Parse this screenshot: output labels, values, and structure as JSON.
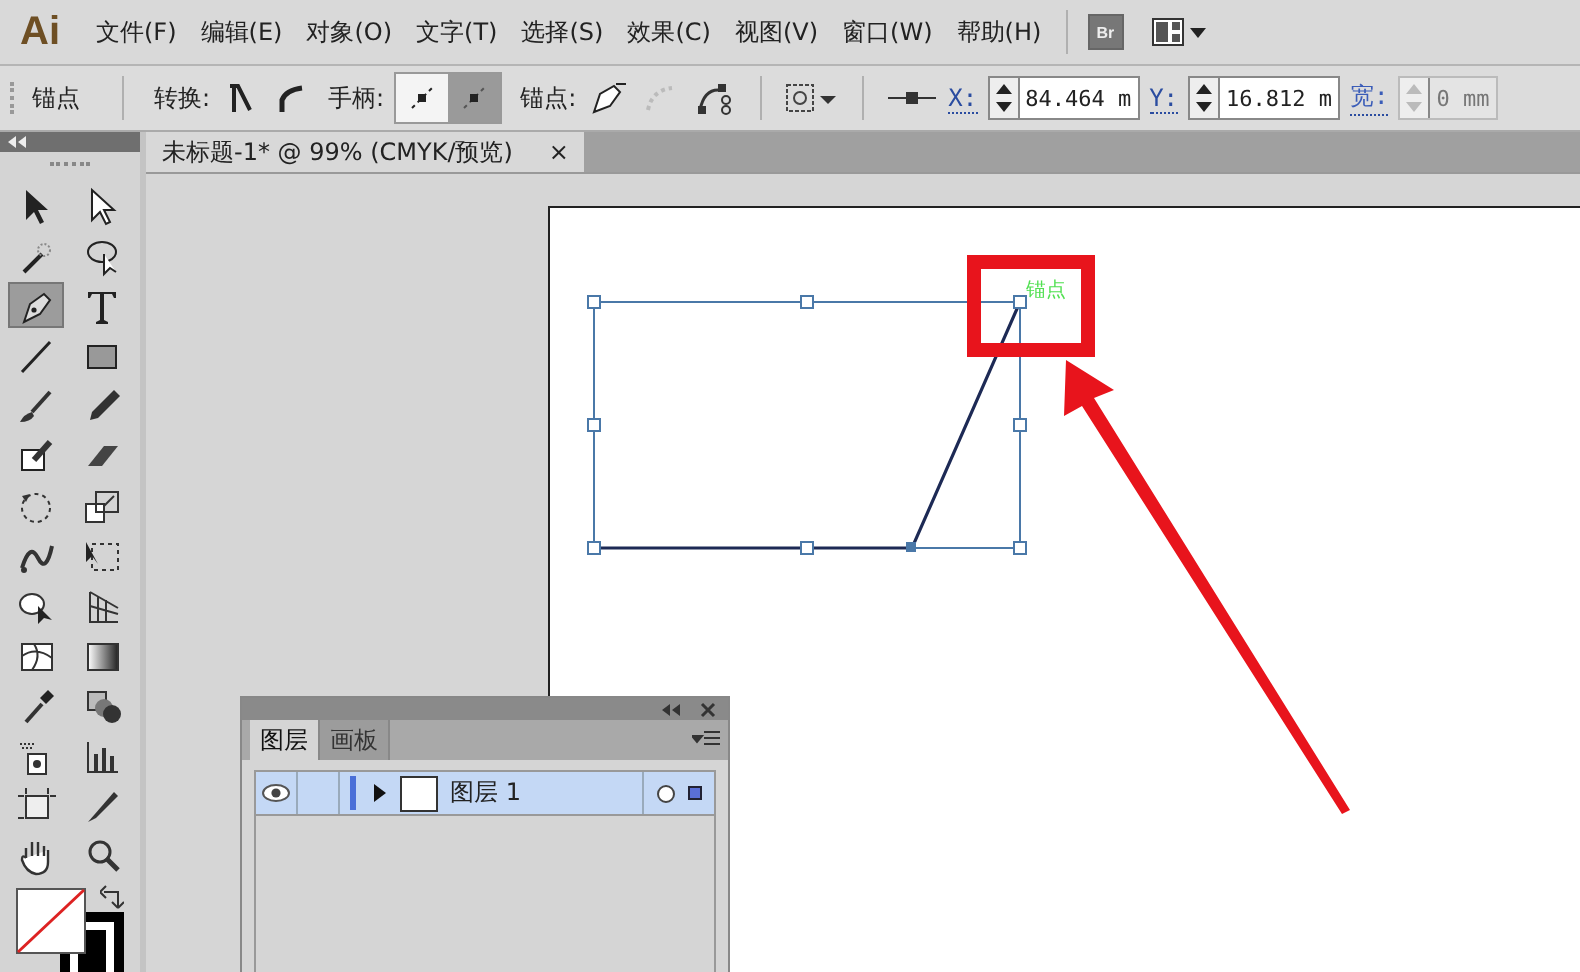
{
  "app": {
    "logo": "Ai",
    "bridge": "Br"
  },
  "menu": [
    "文件(F)",
    "编辑(E)",
    "对象(O)",
    "文字(T)",
    "选择(S)",
    "效果(C)",
    "视图(V)",
    "窗口(W)",
    "帮助(H)"
  ],
  "control_bar": {
    "label": "锚点",
    "convert_label": "转换:",
    "handles_label": "手柄:",
    "handle_buttons": [
      {
        "selected": false
      },
      {
        "selected": true
      }
    ],
    "anchors_label": "锚点:",
    "fields": [
      {
        "label": "X:",
        "value": "84.464 m",
        "disabled": false
      },
      {
        "label": "Y:",
        "value": "16.812 m",
        "disabled": false
      },
      {
        "label": "宽:",
        "value": "0 mm",
        "disabled": true
      }
    ]
  },
  "document_tab": {
    "title": "未标题-1* @ 99% (CMYK/预览)",
    "close": "×"
  },
  "tools": [
    {
      "kind": "selection",
      "selected": false
    },
    {
      "kind": "direct",
      "selected": false
    },
    {
      "kind": "wand",
      "selected": false
    },
    {
      "kind": "lasso",
      "selected": false
    },
    {
      "kind": "pen",
      "selected": true
    },
    {
      "kind": "type",
      "selected": false
    },
    {
      "kind": "line",
      "selected": false
    },
    {
      "kind": "rect",
      "selected": false
    },
    {
      "kind": "brush",
      "selected": false
    },
    {
      "kind": "pencil",
      "selected": false
    },
    {
      "kind": "blob",
      "selected": false
    },
    {
      "kind": "eraser",
      "selected": false
    },
    {
      "kind": "rotate",
      "selected": false
    },
    {
      "kind": "scale",
      "selected": false
    },
    {
      "kind": "warp",
      "selected": false
    },
    {
      "kind": "transform",
      "selected": false
    },
    {
      "kind": "builder",
      "selected": false
    },
    {
      "kind": "perspective",
      "selected": false
    },
    {
      "kind": "mesh",
      "selected": false
    },
    {
      "kind": "gradient",
      "selected": false
    },
    {
      "kind": "eyedropper",
      "selected": false
    },
    {
      "kind": "blend",
      "selected": false
    },
    {
      "kind": "sprayer",
      "selected": false
    },
    {
      "kind": "graph",
      "selected": false
    },
    {
      "kind": "artboard",
      "selected": false
    },
    {
      "kind": "slice",
      "selected": false
    },
    {
      "kind": "hand",
      "selected": false
    },
    {
      "kind": "zoom",
      "selected": false
    }
  ],
  "canvas": {
    "anchor_label": "锚点"
  },
  "layers_panel": {
    "tabs": [
      {
        "label": "图层",
        "selected": true
      },
      {
        "label": "画板",
        "selected": false
      }
    ],
    "layers": [
      {
        "name": "图层 1",
        "visible": true,
        "selected": true
      }
    ]
  }
}
